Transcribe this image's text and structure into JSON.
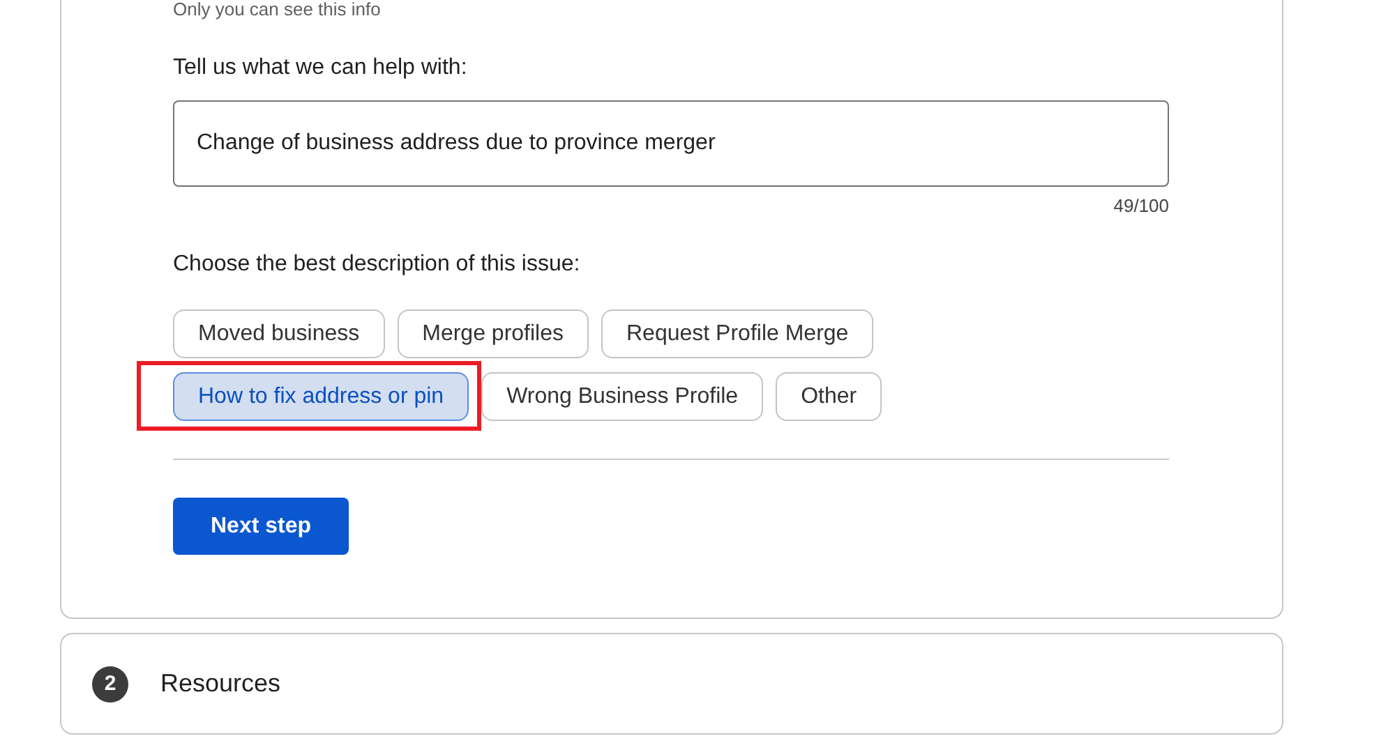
{
  "privacy_note": "Only you can see this info",
  "help_field": {
    "label": "Tell us what we can help with:",
    "value": "Change of business address due to province merger",
    "counter": "49/100"
  },
  "issue_choice": {
    "label": "Choose the best description of this issue:",
    "options": [
      {
        "label": "Moved business",
        "selected": false,
        "highlighted": false
      },
      {
        "label": "Merge profiles",
        "selected": false,
        "highlighted": false
      },
      {
        "label": "Request Profile Merge",
        "selected": false,
        "highlighted": false
      },
      {
        "label": "How to fix address or pin",
        "selected": true,
        "highlighted": true
      },
      {
        "label": "Wrong Business Profile",
        "selected": false,
        "highlighted": false
      },
      {
        "label": "Other",
        "selected": false,
        "highlighted": false
      }
    ]
  },
  "next_button": "Next step",
  "steps": [
    {
      "number": "2",
      "title": "Resources"
    }
  ]
}
